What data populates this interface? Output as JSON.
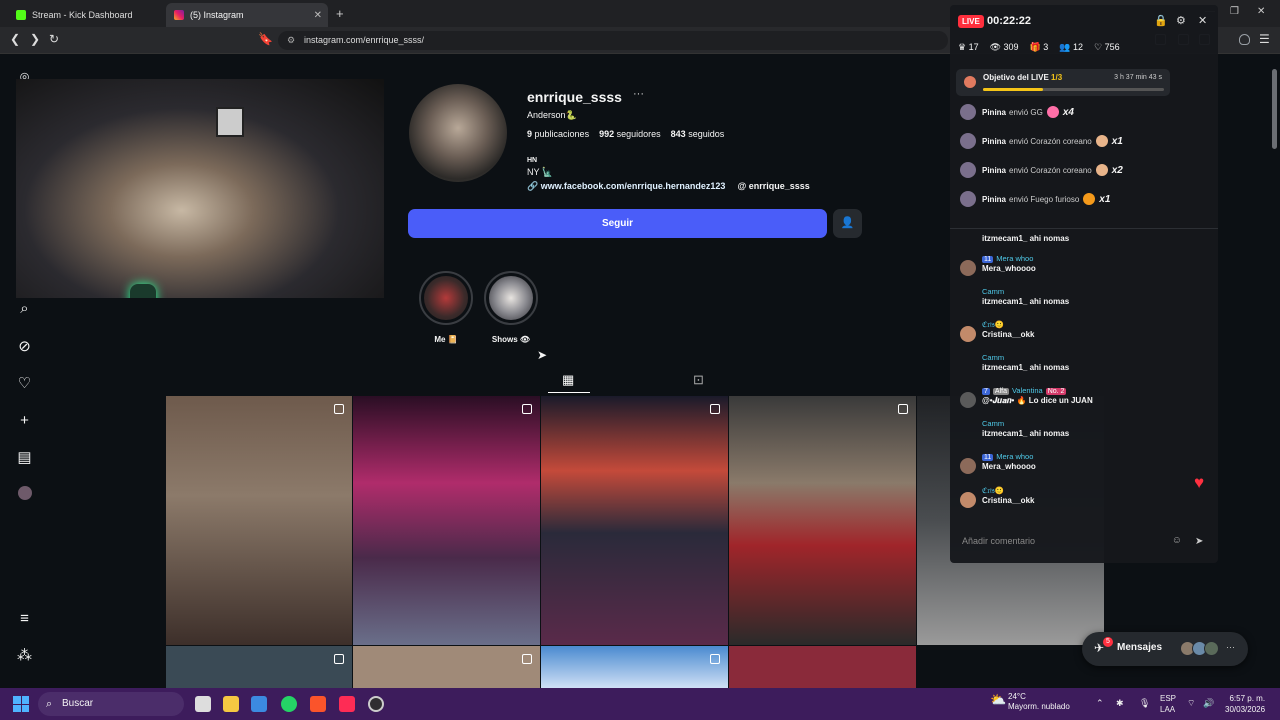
{
  "browser": {
    "tabs": [
      {
        "label": "Stream - Kick Dashboard",
        "active": false
      },
      {
        "label": "(5) Instagram",
        "active": true
      }
    ],
    "url": "instagram.com/enrrique_ssss/"
  },
  "profile": {
    "username": "enrrique_ssss",
    "full_name": "Anderson🐍",
    "posts_count": "9",
    "posts_label": "publicaciones",
    "followers_count": "992",
    "followers_label": "seguidores",
    "following_count": "843",
    "following_label": "seguidos",
    "bio_line1": "HN",
    "bio_line2": "NY 🗽",
    "website": "www.facebook.com/enrrique.hernandez123",
    "threads_handle": "enrrique_ssss",
    "follow_button": "Seguir"
  },
  "highlights": [
    {
      "label": "Me 📔"
    },
    {
      "label": "Shows 👁"
    }
  ],
  "live": {
    "badge": "LIVE",
    "timer": "00:22:22",
    "stats": [
      "17",
      "309",
      "3",
      "12",
      "756"
    ],
    "goal": {
      "label": "Objetivo del LIVE",
      "progress_text": "1/3",
      "time_left": "3 h 37 min 43 s",
      "progress": 0.33
    },
    "gifts": [
      {
        "user": "Pinina",
        "action": "envió GG",
        "count": "x4"
      },
      {
        "user": "Pinina",
        "action": "envió Corazón coreano",
        "count": "x1"
      },
      {
        "user": "Pinina",
        "action": "envió Corazón coreano",
        "count": "x2"
      },
      {
        "user": "Pinina",
        "action": "envió Fuego furioso",
        "count": "x1"
      }
    ],
    "comments": [
      {
        "user": "",
        "text": "itzmecam1_ ahi nomas"
      },
      {
        "user": "Mera whoo",
        "level": "11",
        "text": "Mera_whoooo"
      },
      {
        "user": "Camm",
        "text": "itzmecam1_ ahi nomas"
      },
      {
        "user": "ℭ𝔯𝔦𝔰🙂",
        "text": "Cristina__okk"
      },
      {
        "user": "Camm",
        "text": "itzmecam1_ ahi nomas"
      },
      {
        "user": "Valentina",
        "level": "7",
        "tag": "Alfa",
        "rank": "No. 2",
        "text": "@•𝑱𝒖𝒂𝒏• 🔥 Lo dice un JUAN"
      },
      {
        "user": "Camm",
        "text": "itzmecam1_ ahi nomas"
      },
      {
        "user": "Mera whoo",
        "level": "11",
        "text": "Mera_whoooo"
      },
      {
        "user": "ℭ𝔯𝔦𝔰🙂",
        "text": "Cristina__okk"
      }
    ],
    "comment_placeholder": "Añadir comentario"
  },
  "messages": {
    "label": "Mensajes",
    "badge": "5"
  },
  "taskbar": {
    "search": "Buscar",
    "weather_temp": "24°C",
    "weather_desc": "Mayorm. nublado",
    "lang1": "ESP",
    "lang2": "LAA",
    "time": "6:57 p. m.",
    "date": "30/03/2026"
  },
  "colors": {
    "follow": "#4a5df9",
    "live": "#ff2f3d",
    "taskbar": "#3d1c5c",
    "heart": "#ff3040"
  }
}
